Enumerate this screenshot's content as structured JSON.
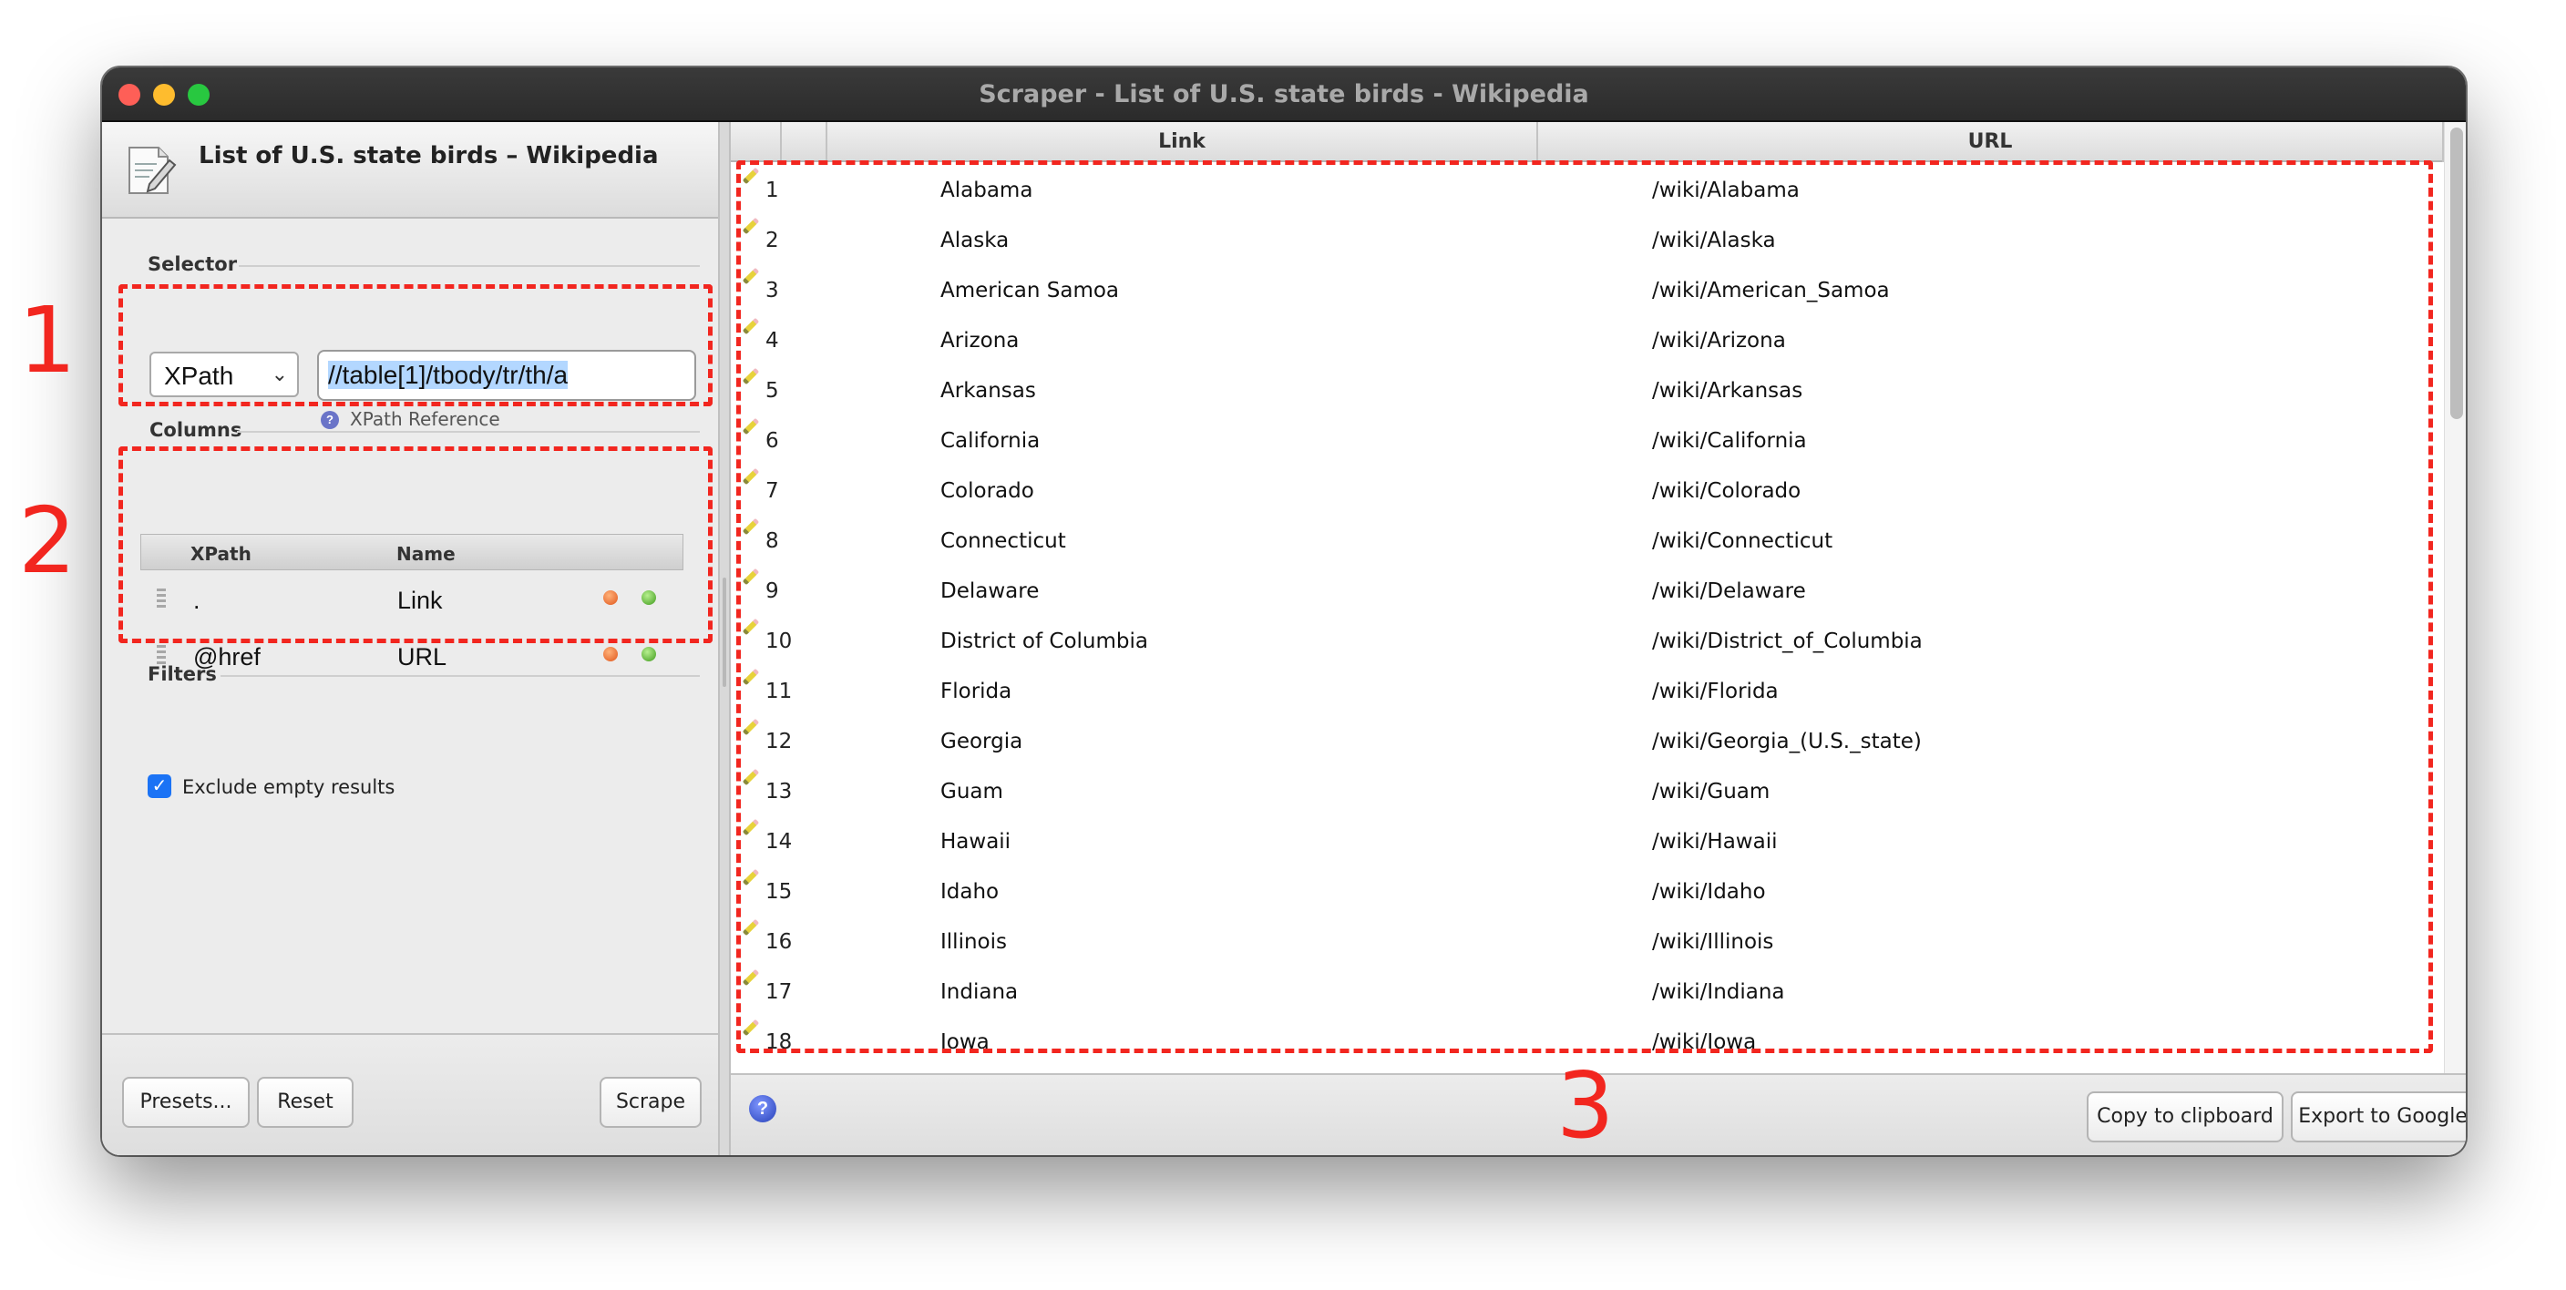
{
  "window": {
    "title": "Scraper - List of U.S. state birds - Wikipedia"
  },
  "left_panel": {
    "page_title": "List of U.S. state birds – Wikipedia",
    "selector": {
      "section_label": "Selector",
      "type_value": "XPath",
      "xpath_value": "//table[1]/tbody/tr/th/a",
      "reference_link": "XPath Reference"
    },
    "columns": {
      "section_label": "Columns",
      "headers": [
        "XPath",
        "Name"
      ],
      "rows": [
        {
          "xpath": ".",
          "name": "Link"
        },
        {
          "xpath": "@href",
          "name": "URL"
        }
      ]
    },
    "filters": {
      "section_label": "Filters",
      "exclude_empty_label": "Exclude empty results",
      "exclude_empty_checked": true
    },
    "buttons": {
      "presets": "Presets...",
      "reset": "Reset",
      "scrape": "Scrape"
    }
  },
  "results": {
    "headers": [
      "Link",
      "URL"
    ],
    "rows": [
      {
        "n": "1",
        "link": "Alabama",
        "url": "/wiki/Alabama"
      },
      {
        "n": "2",
        "link": "Alaska",
        "url": "/wiki/Alaska"
      },
      {
        "n": "3",
        "link": "American Samoa",
        "url": "/wiki/American_Samoa"
      },
      {
        "n": "4",
        "link": "Arizona",
        "url": "/wiki/Arizona"
      },
      {
        "n": "5",
        "link": "Arkansas",
        "url": "/wiki/Arkansas"
      },
      {
        "n": "6",
        "link": "California",
        "url": "/wiki/California"
      },
      {
        "n": "7",
        "link": "Colorado",
        "url": "/wiki/Colorado"
      },
      {
        "n": "8",
        "link": "Connecticut",
        "url": "/wiki/Connecticut"
      },
      {
        "n": "9",
        "link": "Delaware",
        "url": "/wiki/Delaware"
      },
      {
        "n": "10",
        "link": "District of Columbia",
        "url": "/wiki/District_of_Columbia"
      },
      {
        "n": "11",
        "link": "Florida",
        "url": "/wiki/Florida"
      },
      {
        "n": "12",
        "link": "Georgia",
        "url": "/wiki/Georgia_(U.S._state)"
      },
      {
        "n": "13",
        "link": "Guam",
        "url": "/wiki/Guam"
      },
      {
        "n": "14",
        "link": "Hawaii",
        "url": "/wiki/Hawaii"
      },
      {
        "n": "15",
        "link": "Idaho",
        "url": "/wiki/Idaho"
      },
      {
        "n": "16",
        "link": "Illinois",
        "url": "/wiki/Illinois"
      },
      {
        "n": "17",
        "link": "Indiana",
        "url": "/wiki/Indiana"
      },
      {
        "n": "18",
        "link": "Iowa",
        "url": "/wiki/Iowa"
      }
    ],
    "buttons": {
      "copy": "Copy to clipboard",
      "export": "Export to Google Docs..."
    }
  },
  "annotations": [
    "1",
    "2",
    "3"
  ],
  "colors": {
    "annotation": "#f2261f",
    "checkbox": "#1b73f5",
    "selection": "#b3d7ff"
  }
}
